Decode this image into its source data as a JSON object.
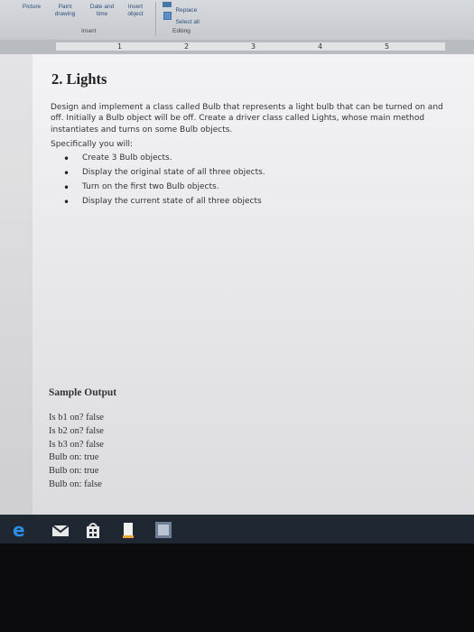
{
  "ribbon": {
    "picture": "Picture",
    "paint_drawing": "Paint drawing",
    "date_time": "Date and time",
    "insert_object": "Insert object",
    "group_insert": "Insert",
    "replace": "Replace",
    "select_all": "Select all",
    "group_editing": "Editing"
  },
  "ruler": {
    "marks": [
      "1",
      "2",
      "3",
      "4",
      "5"
    ]
  },
  "doc": {
    "heading": "2. Lights",
    "paragraph": "Design and implement a class called Bulb that represents a light bulb that can be turned on and off. Initially a Bulb object will be off. Create a driver class called Lights, whose main method instantiates and turns on some Bulb objects.",
    "spec_intro": "Specifically you will:",
    "bullets": [
      "Create 3 Bulb objects.",
      "Display the original state of all three objects.",
      "Turn on the first two Bulb objects.",
      "Display the current state of all three objects"
    ],
    "sample_heading": "Sample Output",
    "output_lines": [
      "Is b1 on? false",
      "Is b2 on? false",
      "Is b3 on? false",
      "Bulb on: true",
      "Bulb on: true",
      "Bulb on: false"
    ]
  },
  "taskbar": {
    "icons": [
      "edge-icon",
      "mail-icon",
      "store-icon",
      "file-icon",
      "app-icon"
    ]
  }
}
